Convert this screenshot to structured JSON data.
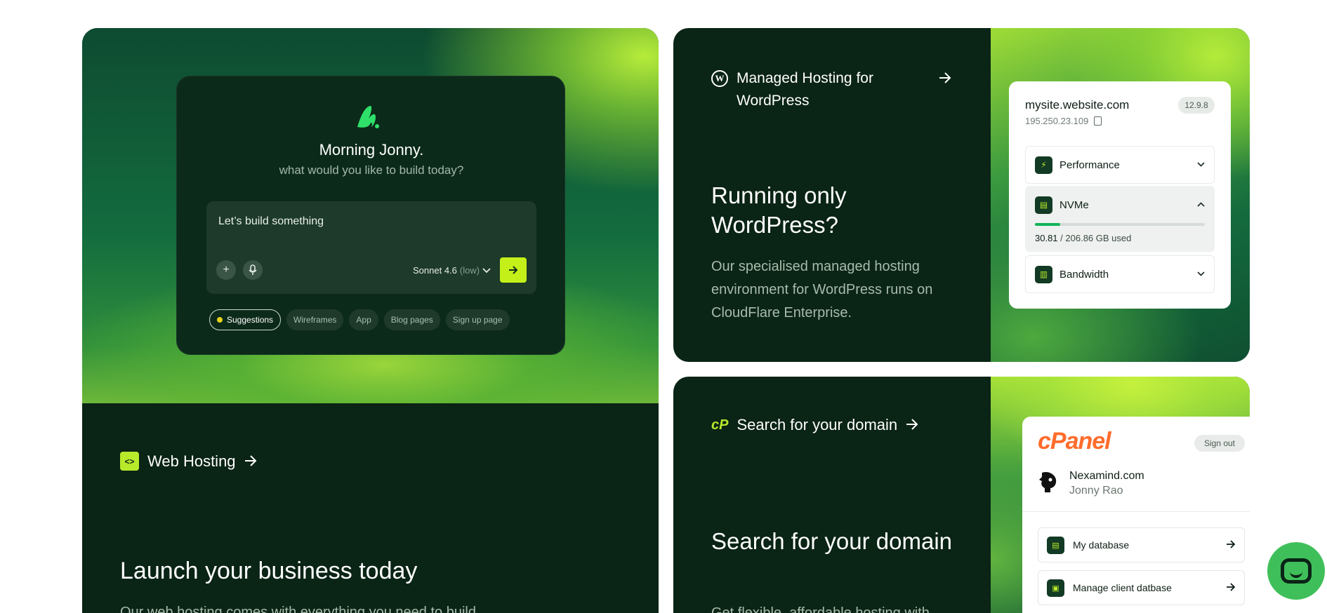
{
  "ai_builder": {
    "greeting": "Morning Jonny.",
    "subtitle": "what would you like to build today?",
    "prompt_value": "Let’s build something",
    "model_name": "Sonnet 4.6",
    "model_mode": "(low)",
    "chips": [
      "Suggestions",
      "Wireframes",
      "App",
      "Blog pages",
      "Sign up page"
    ]
  },
  "web_hosting": {
    "label": "Web Hosting",
    "heading": "Launch your business today",
    "description": "Our web hosting comes with everything you need to build"
  },
  "wordpress": {
    "label": "Managed Hosting for WordPress",
    "heading": "Running only WordPress?",
    "description": "Our specialised managed hosting environment for WordPress runs on CloudFlare Enterprise.",
    "site": {
      "host": "mysite.website.com",
      "ip": "195.250.23.109",
      "version": "12.9.8",
      "features": [
        "Performance",
        "NVMe",
        "Bandwidth"
      ],
      "nvme_used": "30.81",
      "nvme_total": "/ 206.86 GB used",
      "nvme_fraction": 0.149
    }
  },
  "domain": {
    "label": "Search for your domain",
    "heading": "Search for your domain",
    "description": "Get flexible, affordable hosting with",
    "cpanel": {
      "logo": "cPanel",
      "signout": "Sign out",
      "site": "Nexamind.com",
      "user": "Jonny Rao",
      "items": [
        "My database",
        "Manage client datbase"
      ]
    }
  },
  "colors": {
    "accent": "#c4f019",
    "dark_green": "#0a2415",
    "cpanel_orange": "#ff6c2c",
    "chat_green": "#3fbf5a"
  },
  "icons": [
    "ai-logo-icon",
    "plus-icon",
    "mic-icon",
    "chevron-down-icon",
    "arrow-right-icon",
    "code-icon",
    "wordpress-icon",
    "copy-icon",
    "bolt-icon",
    "storage-icon",
    "chart-icon",
    "cpanel-icon",
    "user-avatar-icon",
    "chat-icon"
  ]
}
